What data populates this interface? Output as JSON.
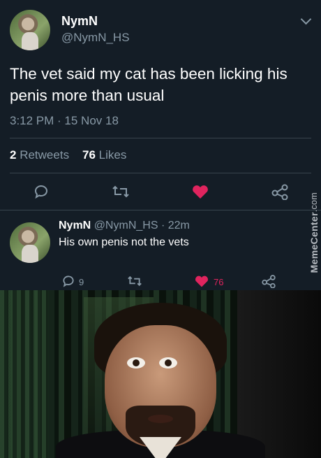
{
  "tweet": {
    "display_name": "NymN",
    "handle": "@NymN_HS",
    "text": "The vet said my cat has been licking his penis more than usual",
    "timestamp": "3:12 PM · 15 Nov 18",
    "retweets_count": "2",
    "retweets_label": "Retweets",
    "likes_count": "76",
    "likes_label": "Likes"
  },
  "reply": {
    "display_name": "NymN",
    "handle_time": "@NymN_HS · 22m",
    "text": "His own penis not the vets",
    "reply_count": "9",
    "like_count": "76"
  },
  "watermark": {
    "brand": "MemeCenter",
    "domain": ".com"
  },
  "colors": {
    "background": "#141d26",
    "muted": "#8899a6",
    "like": "#e0245e"
  },
  "icons": [
    "reply-icon",
    "retweet-icon",
    "heart-icon",
    "share-icon",
    "chevron-down-icon"
  ]
}
